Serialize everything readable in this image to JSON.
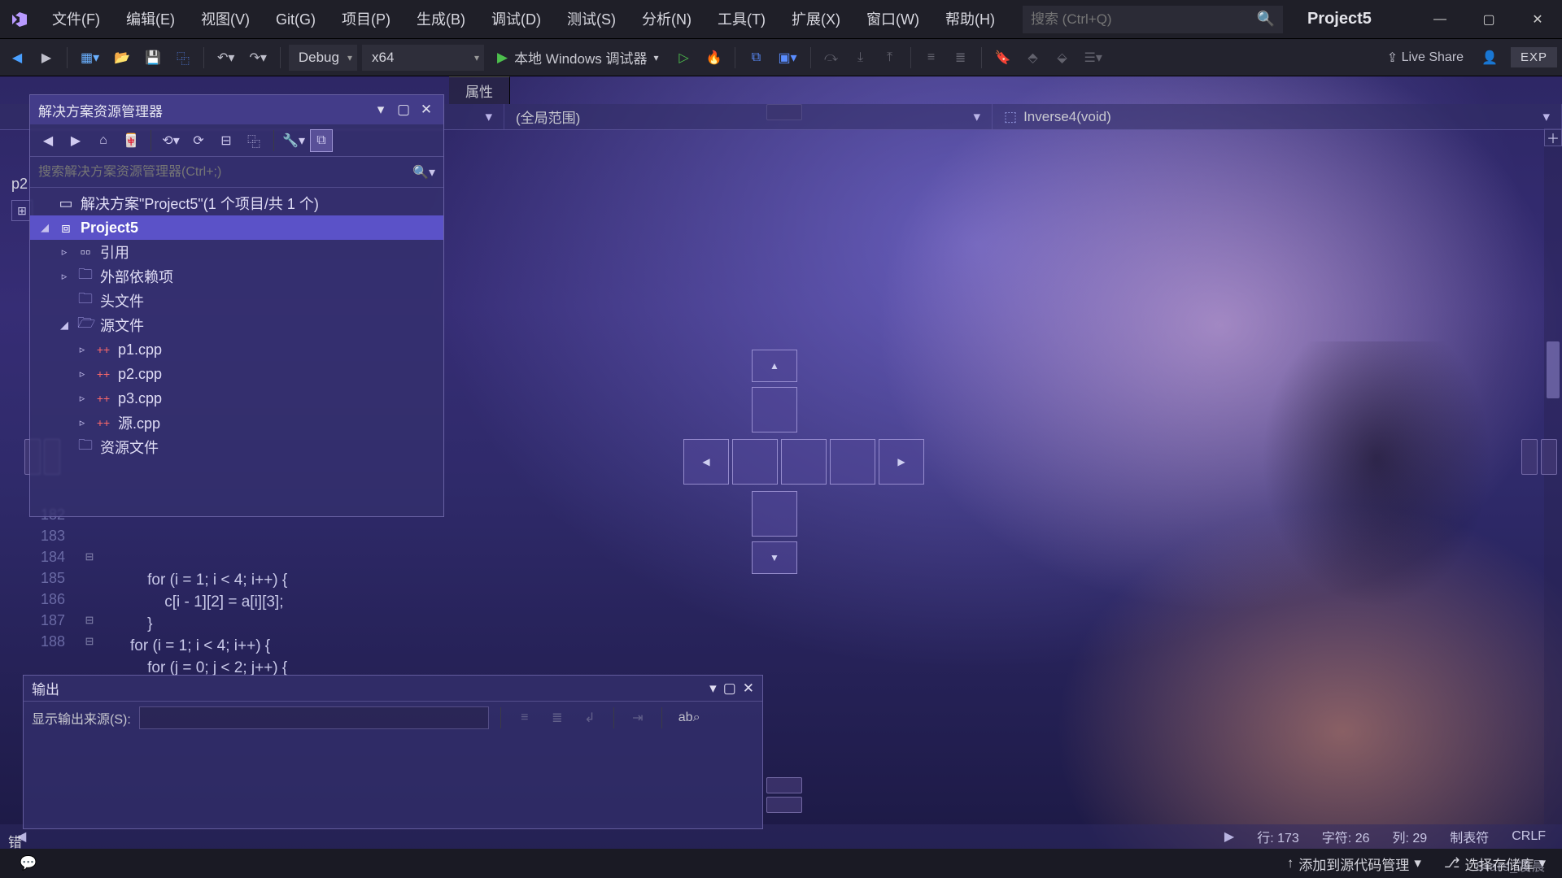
{
  "app": {
    "project_name": "Project5"
  },
  "menu": {
    "items": [
      "文件(F)",
      "编辑(E)",
      "视图(V)",
      "Git(G)",
      "项目(P)",
      "生成(B)",
      "调试(D)",
      "测试(S)",
      "分析(N)",
      "工具(T)",
      "扩展(X)",
      "窗口(W)",
      "帮助(H)"
    ]
  },
  "search": {
    "placeholder": "搜索 (Ctrl+Q)"
  },
  "toolbar": {
    "config": "Debug",
    "platform": "x64",
    "debugger": "本地 Windows 调试器",
    "live_share": "Live Share",
    "exp": "EXP"
  },
  "tabs": {
    "p2": "p2",
    "properties": "属性"
  },
  "breadcrumb": {
    "scope": "(全局范围)",
    "symbol": "Inverse4(void)"
  },
  "solution_explorer": {
    "title": "解决方案资源管理器",
    "search_placeholder": "搜索解决方案资源管理器(Ctrl+;)",
    "solution_label": "解决方案\"Project5\"(1 个项目/共 1 个)",
    "project": "Project5",
    "nodes": {
      "references": "引用",
      "external": "外部依赖项",
      "headers": "头文件",
      "sources": "源文件",
      "resources": "资源文件"
    },
    "files": [
      "p1.cpp",
      "p2.cpp",
      "p3.cpp",
      "源.cpp"
    ]
  },
  "output_panel": {
    "title": "输出",
    "source_label": "显示输出来源(S):"
  },
  "code": {
    "lines": [
      {
        "n": 182,
        "t": ""
      },
      {
        "n": 183,
        "t": ""
      },
      {
        "n": 184,
        "t": "    for (i = 1; i < 4; i++) {"
      },
      {
        "n": 185,
        "t": "        c[i - 1][2] = a[i][3];"
      },
      {
        "n": 186,
        "t": "    }"
      },
      {
        "n": 187,
        "t": "for (i = 1; i < 4; i++) {"
      },
      {
        "n": 188,
        "t": "    for (j = 0; j < 2; j++) {"
      }
    ]
  },
  "status": {
    "line": "行: 173",
    "char": "字符: 26",
    "col": "列: 29",
    "tabs": "制表符",
    "eol": "CRLF"
  },
  "bottom": {
    "add_source_control": "添加到源代码管理",
    "select_repo": "选择存储库"
  },
  "error_list_tab": "错",
  "watermark": "Stars_凌晨"
}
